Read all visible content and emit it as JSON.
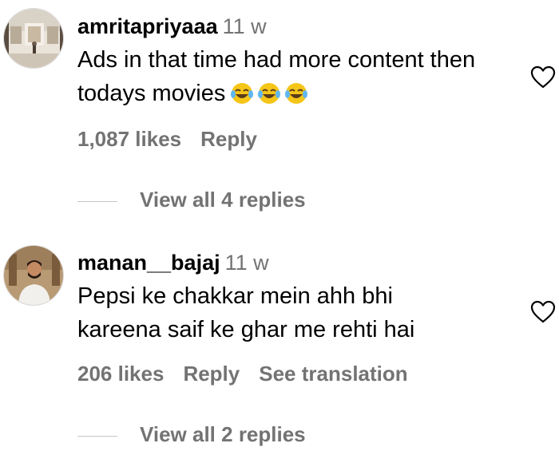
{
  "comments": [
    {
      "username": "amritapriyaaa",
      "time": "11 w",
      "text": "Ads in that time had more content then todays movies",
      "emoji": [
        "face-with-tears-of-joy",
        "face-with-tears-of-joy",
        "face-with-tears-of-joy"
      ],
      "likes": "1,087 likes",
      "reply": "Reply",
      "view_replies": "View all 4 replies"
    },
    {
      "username": "manan__bajaj",
      "time": "11 w",
      "text_line1": "Pepsi ke chakkar mein ahh bhi",
      "text_line2": "kareena saif ke ghar me rehti hai",
      "likes": "206 likes",
      "reply": "Reply",
      "see_translation": "See translation",
      "view_replies": "View all 2 replies"
    }
  ],
  "colors": {
    "secondary_text": "#737373",
    "primary_text": "#000000",
    "divider": "#c7c7c7"
  }
}
